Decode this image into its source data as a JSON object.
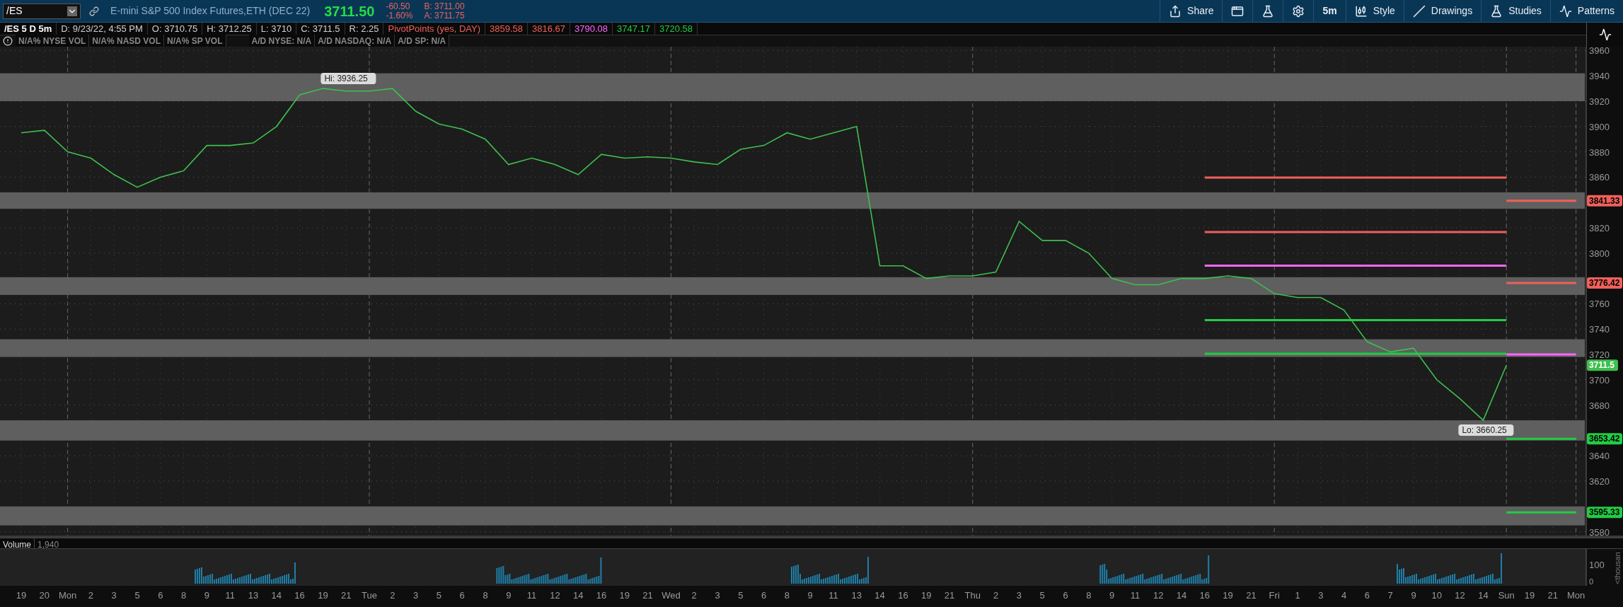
{
  "header": {
    "symbol": "/ES",
    "description": "E-mini S&P 500 Index Futures,ETH (DEC 22)",
    "last": "3711.50",
    "change": "-60.50",
    "change_pct": "-1.60%",
    "bid": "B: 3711.00",
    "ask": "A: 3711.75",
    "toolbar": [
      {
        "kind": "share",
        "label": "Share"
      },
      {
        "kind": "alerts"
      },
      {
        "kind": "lab"
      },
      {
        "kind": "settings"
      },
      {
        "kind": "interval",
        "label": "5m"
      },
      {
        "kind": "style",
        "label": "Style"
      },
      {
        "kind": "drawings",
        "label": "Drawings"
      },
      {
        "kind": "studies",
        "label": "Studies"
      },
      {
        "kind": "patterns",
        "label": "Patterns"
      }
    ]
  },
  "info_bar": [
    {
      "text": "/ES 5 D 5m",
      "color": "#ffffff"
    },
    {
      "text": "D: 9/23/22, 4:55 PM",
      "color": "#d0d0d0"
    },
    {
      "text": "O: 3710.75",
      "color": "#d0d0d0"
    },
    {
      "text": "H: 3712.25",
      "color": "#d0d0d0"
    },
    {
      "text": "L: 3710",
      "color": "#d0d0d0"
    },
    {
      "text": "C: 3711.5",
      "color": "#d0d0d0"
    },
    {
      "text": "R: 2.25",
      "color": "#d0d0d0"
    },
    {
      "text": "PivotPoints (yes, DAY)",
      "color": "#f0605a"
    },
    {
      "text": "3859.58",
      "color": "#f0605a"
    },
    {
      "text": "3816.67",
      "color": "#f0605a"
    },
    {
      "text": "3790.08",
      "color": "#ff66ff"
    },
    {
      "text": "3747.17",
      "color": "#22cc44"
    },
    {
      "text": "3720.58",
      "color": "#22cc44"
    }
  ],
  "indicators": [
    "N/A% NYSE VOL",
    "N/A% NASD VOL",
    "N/A% SP VOL",
    "A/D NYSE: N/A",
    "A/D NASDAQ: N/A",
    "A/D SP: N/A"
  ],
  "chart_data": {
    "type": "line",
    "categories": [
      "19",
      "20",
      "Mon",
      "2",
      "3",
      "5",
      "6",
      "8",
      "9",
      "11",
      "13",
      "14",
      "16",
      "19",
      "21",
      "Tue",
      "2",
      "3",
      "5",
      "6",
      "8",
      "9",
      "11",
      "12",
      "14",
      "16",
      "19",
      "21",
      "Wed",
      "2",
      "3",
      "5",
      "6",
      "8",
      "9",
      "11",
      "13",
      "14",
      "16",
      "19",
      "21",
      "Thu",
      "2",
      "3",
      "5",
      "6",
      "8",
      "9",
      "11",
      "12",
      "14",
      "16",
      "19",
      "21",
      "Fri",
      "1",
      "3",
      "4",
      "6",
      "7",
      "9",
      "10",
      "12",
      "14",
      "Sun",
      "19",
      "21",
      "Mon"
    ],
    "series": [
      {
        "color": "#f0605a",
        "values": [
          null,
          null,
          null,
          null,
          null,
          null,
          null,
          null,
          null,
          null,
          null,
          null,
          null,
          null,
          null,
          null,
          null,
          null,
          null,
          null,
          null,
          null,
          null,
          null,
          null,
          null,
          null,
          null,
          null,
          null,
          null,
          null,
          null,
          null,
          null,
          null,
          null,
          null,
          null,
          null,
          null,
          null,
          null,
          null,
          null,
          null,
          null,
          null,
          null,
          null,
          null,
          3859.58,
          3859.58,
          3859.58,
          3859.58,
          3859.58,
          3859.58,
          3859.58,
          3859.58,
          3859.58,
          3859.58,
          3859.58,
          3859.58,
          3859.58,
          3859.58,
          null,
          null,
          null
        ]
      },
      {
        "color": "#f0605a",
        "values": [
          null,
          null,
          null,
          null,
          null,
          null,
          null,
          null,
          null,
          null,
          null,
          null,
          null,
          null,
          null,
          null,
          null,
          null,
          null,
          null,
          null,
          null,
          null,
          null,
          null,
          null,
          null,
          null,
          null,
          null,
          null,
          null,
          null,
          null,
          null,
          null,
          null,
          null,
          null,
          null,
          null,
          null,
          null,
          null,
          null,
          null,
          null,
          null,
          null,
          null,
          null,
          3816.67,
          3816.67,
          3816.67,
          3816.67,
          3816.67,
          3816.67,
          3816.67,
          3816.67,
          3816.67,
          3816.67,
          3816.67,
          3816.67,
          3816.67,
          3816.67,
          null,
          null,
          null
        ]
      },
      {
        "color": "#ff66ff",
        "values": [
          null,
          null,
          null,
          null,
          null,
          null,
          null,
          null,
          null,
          null,
          null,
          null,
          null,
          null,
          null,
          null,
          null,
          null,
          null,
          null,
          null,
          null,
          null,
          null,
          null,
          null,
          null,
          null,
          null,
          null,
          null,
          null,
          null,
          null,
          null,
          null,
          null,
          null,
          null,
          null,
          null,
          null,
          null,
          null,
          null,
          null,
          null,
          null,
          null,
          null,
          null,
          3790.08,
          3790.08,
          3790.08,
          3790.08,
          3790.08,
          3790.08,
          3790.08,
          3790.08,
          3790.08,
          3790.08,
          3790.08,
          3790.08,
          3790.08,
          3790.08,
          null,
          null,
          null
        ]
      },
      {
        "color": "#22cc44",
        "values": [
          null,
          null,
          null,
          null,
          null,
          null,
          null,
          null,
          null,
          null,
          null,
          null,
          null,
          null,
          null,
          null,
          null,
          null,
          null,
          null,
          null,
          null,
          null,
          null,
          null,
          null,
          null,
          null,
          null,
          null,
          null,
          null,
          null,
          null,
          null,
          null,
          null,
          null,
          null,
          null,
          null,
          null,
          null,
          null,
          null,
          null,
          null,
          null,
          null,
          null,
          null,
          3747.17,
          3747.17,
          3747.17,
          3747.17,
          3747.17,
          3747.17,
          3747.17,
          3747.17,
          3747.17,
          3747.17,
          3747.17,
          3747.17,
          3747.17,
          3747.17,
          null,
          null,
          null
        ]
      },
      {
        "color": "#22cc44",
        "values": [
          null,
          null,
          null,
          null,
          null,
          null,
          null,
          null,
          null,
          null,
          null,
          null,
          null,
          null,
          null,
          null,
          null,
          null,
          null,
          null,
          null,
          null,
          null,
          null,
          null,
          null,
          null,
          null,
          null,
          null,
          null,
          null,
          null,
          null,
          null,
          null,
          null,
          null,
          null,
          null,
          null,
          null,
          null,
          null,
          null,
          null,
          null,
          null,
          null,
          null,
          null,
          3720.58,
          3720.58,
          3720.58,
          3720.58,
          3720.58,
          3720.58,
          3720.58,
          3720.58,
          3720.58,
          3720.58,
          3720.58,
          3720.58,
          3720.58,
          3720.58,
          null,
          null,
          null
        ]
      },
      {
        "color": "#ff66ff",
        "values": [
          null,
          null,
          null,
          null,
          null,
          null,
          null,
          null,
          null,
          null,
          null,
          null,
          null,
          null,
          null,
          null,
          null,
          null,
          null,
          null,
          null,
          null,
          null,
          null,
          null,
          null,
          null,
          null,
          null,
          null,
          null,
          null,
          null,
          null,
          null,
          null,
          null,
          null,
          null,
          null,
          null,
          null,
          null,
          null,
          null,
          null,
          null,
          null,
          null,
          null,
          null,
          null,
          null,
          null,
          null,
          null,
          null,
          null,
          null,
          null,
          null,
          null,
          null,
          null,
          3720,
          3720,
          3720,
          3720
        ]
      },
      {
        "color": "#3fbf4f",
        "values": [
          3895,
          3897,
          3880,
          3875,
          3862,
          3852,
          3860,
          3865,
          3885,
          3885,
          3887,
          3900,
          3925,
          3930,
          3928,
          3928,
          3930,
          3912,
          3902,
          3898,
          3890,
          3870,
          3875,
          3870,
          3862,
          3878,
          3875,
          3876,
          3875,
          3872,
          3870,
          3882,
          3885,
          3895,
          3890,
          3895,
          3900,
          3790,
          3790,
          3780,
          3782,
          3782,
          3785,
          3825,
          3810,
          3810,
          3800,
          3780,
          3775,
          3775,
          3780,
          3780,
          3782,
          3780,
          3768,
          3765,
          3765,
          3755,
          3730,
          3722,
          3725,
          3700,
          3685,
          3668,
          3711.5,
          null,
          null,
          null
        ]
      }
    ],
    "ylim": [
      3577,
      3963
    ],
    "grid": true,
    "yticks": [
      3960,
      3940,
      3920,
      3900,
      3880,
      3860,
      3820,
      3800,
      3760,
      3740,
      3720,
      3700,
      3680,
      3640,
      3620,
      3580
    ],
    "bands": [
      {
        "axis": "y",
        "from": 3920,
        "to": 3942
      },
      {
        "axis": "y",
        "from": 3835,
        "to": 3848
      },
      {
        "axis": "y",
        "from": 3767,
        "to": 3781
      },
      {
        "axis": "y",
        "from": 3718,
        "to": 3732
      },
      {
        "axis": "y",
        "from": 3652,
        "to": 3668
      },
      {
        "axis": "y",
        "from": 3585,
        "to": 3600
      }
    ],
    "ref_lines": [
      {
        "axis": "y",
        "value": 3841.33,
        "color": "#f0605a",
        "label": "3841.33"
      },
      {
        "axis": "y",
        "value": 3776.42,
        "color": "#f0605a",
        "label": "3776.42"
      },
      {
        "axis": "y",
        "value": 3653.42,
        "color": "#22cc44",
        "label": "3653.42"
      },
      {
        "axis": "y",
        "value": 3595.33,
        "color": "#22cc44",
        "label": "3595.33"
      }
    ],
    "annotations": [
      "Hi: 3936.25",
      "Lo: 3660.25",
      "3711.5"
    ]
  },
  "volume": {
    "label": "Volume",
    "value": "1,940",
    "ticks": [
      "100",
      "0"
    ],
    "unit": "<thousan"
  }
}
